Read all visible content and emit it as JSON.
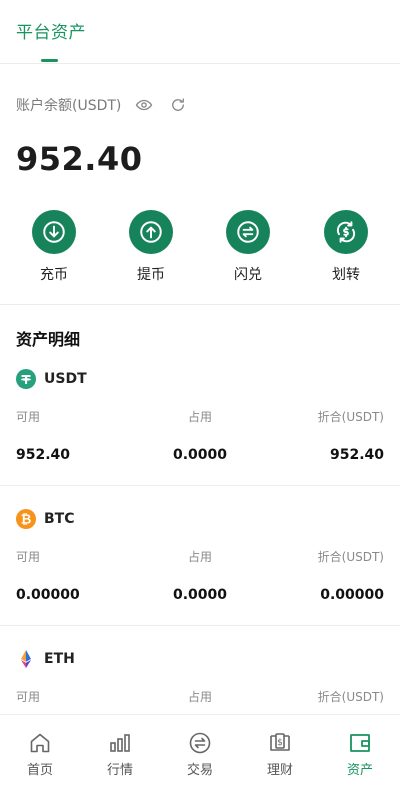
{
  "header": {
    "tab_label": "平台资产"
  },
  "balance": {
    "label": "账户余额(USDT)",
    "value": "952.40"
  },
  "actions": [
    {
      "label": "充币",
      "icon": "download-icon"
    },
    {
      "label": "提币",
      "icon": "upload-icon"
    },
    {
      "label": "闪兑",
      "icon": "exchange-icon"
    },
    {
      "label": "划转",
      "icon": "transfer-icon"
    }
  ],
  "section_title": "资产明细",
  "columns": {
    "available": "可用",
    "occupied": "占用",
    "converted": "折合(USDT)"
  },
  "assets": [
    {
      "name": "USDT",
      "available": "952.40",
      "occupied": "0.0000",
      "converted": "952.40"
    },
    {
      "name": "BTC",
      "available": "0.00000",
      "occupied": "0.0000",
      "converted": "0.00000"
    },
    {
      "name": "ETH"
    }
  ],
  "nav": [
    {
      "label": "首页",
      "icon": "home-icon"
    },
    {
      "label": "行情",
      "icon": "chart-bars-icon"
    },
    {
      "label": "交易",
      "icon": "trade-icon"
    },
    {
      "label": "理财",
      "icon": "finance-icon"
    },
    {
      "label": "资产",
      "icon": "wallet-icon",
      "active": true
    }
  ],
  "colors": {
    "accent": "#17945f",
    "action_circle": "#17835a",
    "usdt": "#26a17b",
    "btc": "#f7931a"
  }
}
